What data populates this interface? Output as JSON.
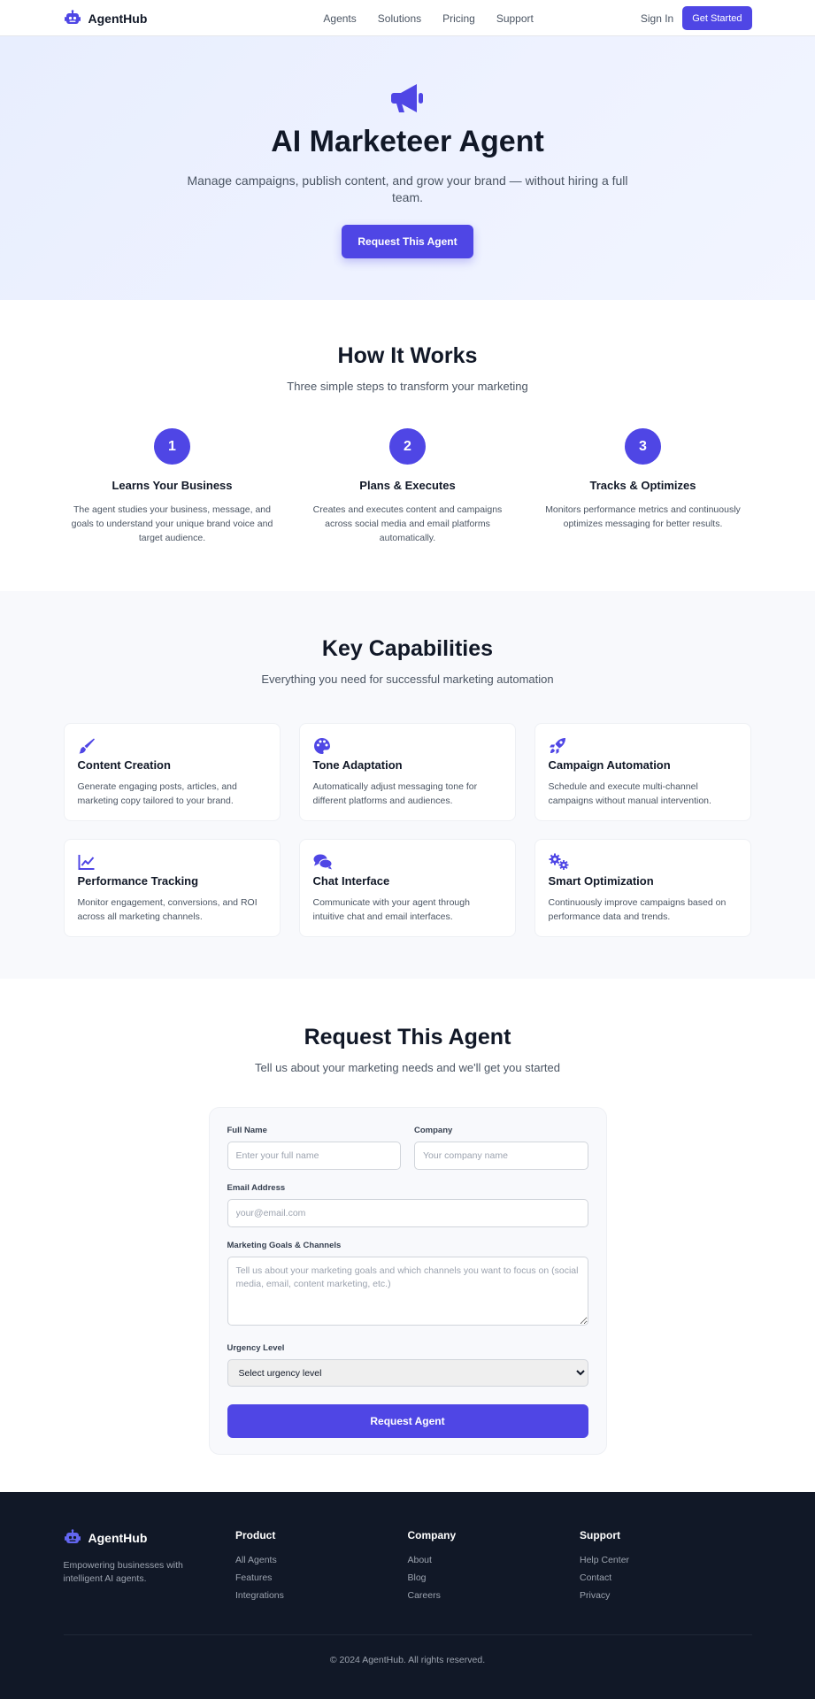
{
  "nav": {
    "brand": "AgentHub",
    "links": [
      "Agents",
      "Solutions",
      "Pricing",
      "Support"
    ],
    "sign_in": "Sign In",
    "cta": "Get Started"
  },
  "hero": {
    "icon": "megaphone-icon",
    "title": "AI Marketeer Agent",
    "subtitle": "Manage campaigns, publish content, and grow your brand — without hiring a full team.",
    "cta": "Request This Agent"
  },
  "how": {
    "title": "How It Works",
    "subtitle": "Three simple steps to transform your marketing",
    "steps": [
      {
        "num": "1",
        "title": "Learns Your Business",
        "text": "The agent studies your business, message, and goals to understand your unique brand voice and target audience."
      },
      {
        "num": "2",
        "title": "Plans & Executes",
        "text": "Creates and executes content and campaigns across social media and email platforms automatically."
      },
      {
        "num": "3",
        "title": "Tracks & Optimizes",
        "text": "Monitors performance metrics and continuously optimizes messaging for better results."
      }
    ]
  },
  "capabilities": {
    "title": "Key Capabilities",
    "subtitle": "Everything you need for successful marketing automation",
    "items": [
      {
        "icon": "paintbrush-icon",
        "title": "Content Creation",
        "text": "Generate engaging posts, articles, and marketing copy tailored to your brand."
      },
      {
        "icon": "palette-icon",
        "title": "Tone Adaptation",
        "text": "Automatically adjust messaging tone for different platforms and audiences."
      },
      {
        "icon": "rocket-icon",
        "title": "Campaign Automation",
        "text": "Schedule and execute multi-channel campaigns without manual intervention."
      },
      {
        "icon": "chart-line-icon",
        "title": "Performance Tracking",
        "text": "Monitor engagement, conversions, and ROI across all marketing channels."
      },
      {
        "icon": "chat-bubbles-icon",
        "title": "Chat Interface",
        "text": "Communicate with your agent through intuitive chat and email interfaces."
      },
      {
        "icon": "gears-icon",
        "title": "Smart Optimization",
        "text": "Continuously improve campaigns based on performance data and trends."
      }
    ]
  },
  "request": {
    "title": "Request This Agent",
    "subtitle": "Tell us about your marketing needs and we'll get you started",
    "form": {
      "full_name_label": "Full Name",
      "full_name_placeholder": "Enter your full name",
      "company_label": "Company",
      "company_placeholder": "Your company name",
      "email_label": "Email Address",
      "email_placeholder": "your@email.com",
      "goals_label": "Marketing Goals & Channels",
      "goals_placeholder": "Tell us about your marketing goals and which channels you want to focus on (social media, email, content marketing, etc.)",
      "urgency_label": "Urgency Level",
      "urgency_selected": "Select urgency level",
      "submit": "Request Agent"
    }
  },
  "footer": {
    "brand": "AgentHub",
    "tagline": "Empowering businesses with intelligent AI agents.",
    "columns": [
      {
        "title": "Product",
        "items": [
          "All Agents",
          "Features",
          "Integrations"
        ]
      },
      {
        "title": "Company",
        "items": [
          "About",
          "Blog",
          "Careers"
        ]
      },
      {
        "title": "Support",
        "items": [
          "Help Center",
          "Contact",
          "Privacy"
        ]
      }
    ],
    "copyright": "© 2024 AgentHub. All rights reserved."
  },
  "colors": {
    "accent": "#4f46e5",
    "footer_bg": "#111827",
    "hero_bg": "#eef2ff"
  }
}
